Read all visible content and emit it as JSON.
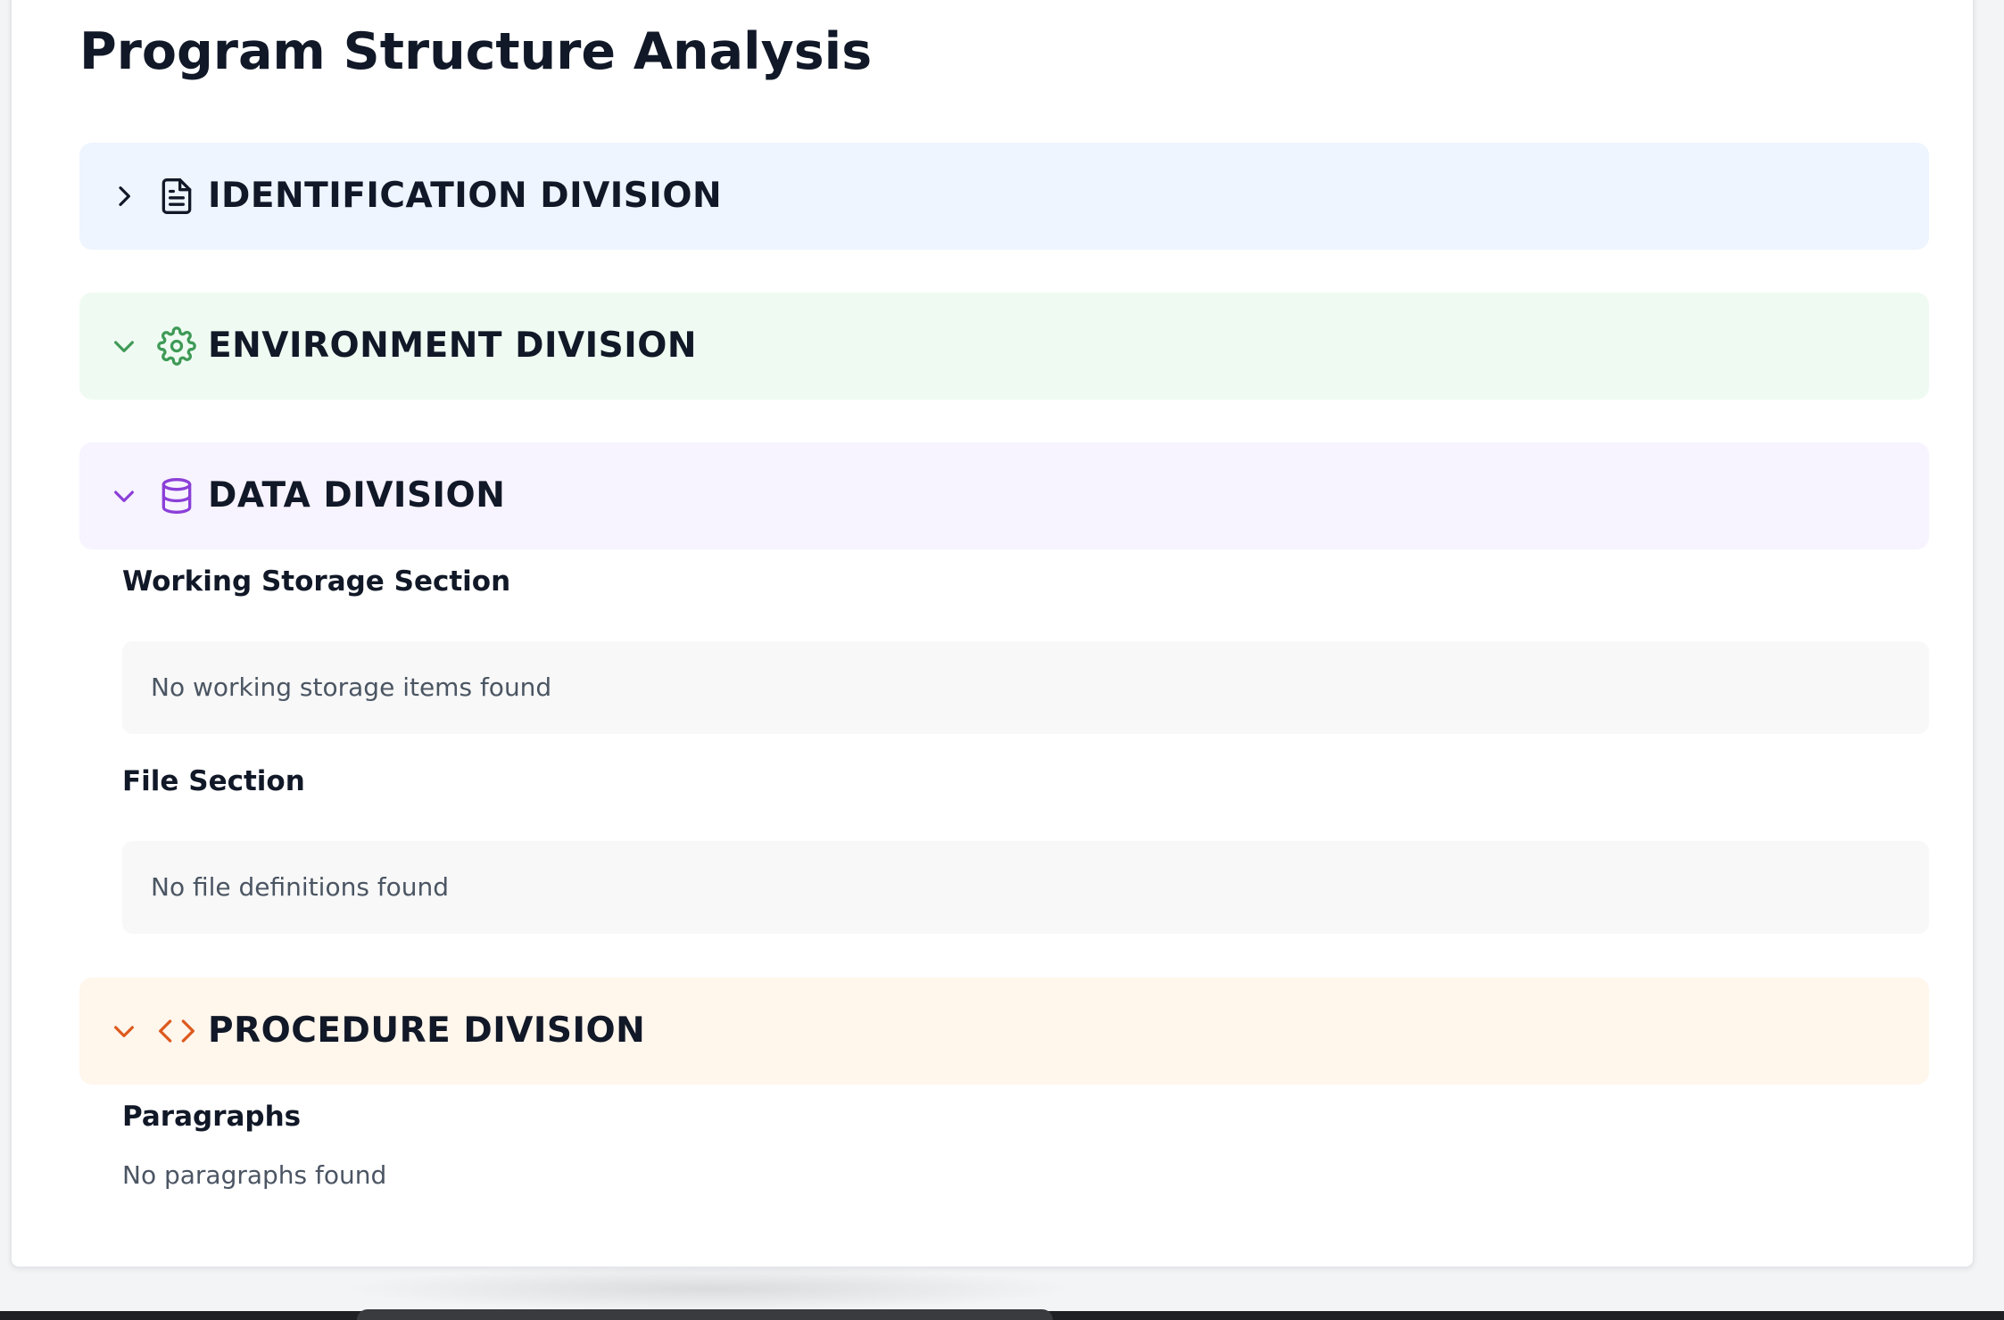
{
  "page": {
    "title": "Program Structure Analysis"
  },
  "divisions": {
    "identification": {
      "title": "IDENTIFICATION DIVISION",
      "expanded": false,
      "icon": "file-text-icon",
      "bg_color": "#eef5ff",
      "accent_color": "#111827"
    },
    "environment": {
      "title": "ENVIRONMENT DIVISION",
      "expanded": true,
      "icon": "gear-icon",
      "bg_color": "#effbf2",
      "accent_color": "#3f9a57"
    },
    "data": {
      "title": "DATA DIVISION",
      "expanded": true,
      "icon": "database-icon",
      "bg_color": "#f7f3ff",
      "accent_color": "#8b3fd8",
      "working_storage": {
        "title": "Working Storage Section",
        "empty_text": "No working storage items found"
      },
      "file_section": {
        "title": "File Section",
        "empty_text": "No file definitions found"
      }
    },
    "procedure": {
      "title": "PROCEDURE DIVISION",
      "expanded": true,
      "icon": "code-icon",
      "bg_color": "#fff6ec",
      "accent_color": "#dd5a1e",
      "paragraphs": {
        "title": "Paragraphs",
        "empty_text": "No paragraphs found"
      }
    }
  }
}
